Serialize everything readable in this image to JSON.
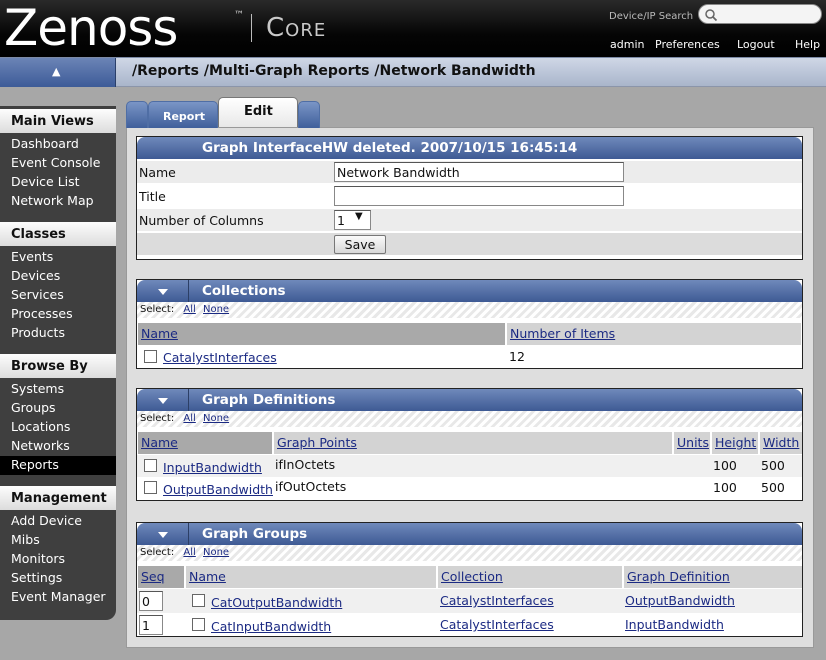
{
  "app": {
    "logo": "Zenoss",
    "tm": "™",
    "edition": "Core"
  },
  "search": {
    "label": "Device/IP Search",
    "placeholder": ""
  },
  "topnav": {
    "user": "admin",
    "preferences": "Preferences",
    "logout": "Logout",
    "help": "Help"
  },
  "breadcrumb": "/Reports /Multi-Graph Reports /Network Bandwidth",
  "sidebar": {
    "main_views": {
      "title": "Main Views",
      "items": [
        "Dashboard",
        "Event Console",
        "Device List",
        "Network Map"
      ]
    },
    "classes": {
      "title": "Classes",
      "items": [
        "Events",
        "Devices",
        "Services",
        "Processes",
        "Products"
      ]
    },
    "browse_by": {
      "title": "Browse By",
      "items": [
        "Systems",
        "Groups",
        "Locations",
        "Networks",
        "Reports"
      ],
      "active": "Reports"
    },
    "management": {
      "title": "Management",
      "items": [
        "Add Device",
        "Mibs",
        "Monitors",
        "Settings",
        "Event Manager"
      ]
    }
  },
  "tabs": {
    "report": "Report",
    "edit": "Edit",
    "active": "Edit"
  },
  "edit_panel": {
    "message": "Graph InterfaceHW deleted. 2007/10/15 16:45:14",
    "name_label": "Name",
    "name_value": "Network Bandwidth",
    "title_label": "Title",
    "title_value": "",
    "columns_label": "Number of Columns",
    "columns_value": "1",
    "save": "Save"
  },
  "select": {
    "label": "Select:",
    "all": "All",
    "none": "None"
  },
  "collections": {
    "title": "Collections",
    "headers": {
      "name": "Name",
      "items": "Number of Items"
    },
    "rows": [
      {
        "name": "CatalystInterfaces",
        "count": "12"
      }
    ]
  },
  "graph_definitions": {
    "title": "Graph Definitions",
    "headers": {
      "name": "Name",
      "points": "Graph Points",
      "units": "Units",
      "height": "Height",
      "width": "Width"
    },
    "rows": [
      {
        "name": "InputBandwidth",
        "points": "ifInOctets",
        "units": "",
        "height": "100",
        "width": "500"
      },
      {
        "name": "OutputBandwidth",
        "points": "ifOutOctets",
        "units": "",
        "height": "100",
        "width": "500"
      }
    ]
  },
  "graph_groups": {
    "title": "Graph Groups",
    "headers": {
      "seq": "Seq",
      "name": "Name",
      "collection": "Collection",
      "definition": "Graph Definition"
    },
    "rows": [
      {
        "seq": "0",
        "name": "CatOutputBandwidth",
        "collection": "CatalystInterfaces",
        "definition": "OutputBandwidth"
      },
      {
        "seq": "1",
        "name": "CatInputBandwidth",
        "collection": "CatalystInterfaces",
        "definition": "InputBandwidth"
      }
    ]
  },
  "colors": {
    "header_bg": "#000000",
    "panel_head": "#4f6ea5",
    "sidebar_bg": "#3f3f3f",
    "link": "#1b2a83"
  }
}
